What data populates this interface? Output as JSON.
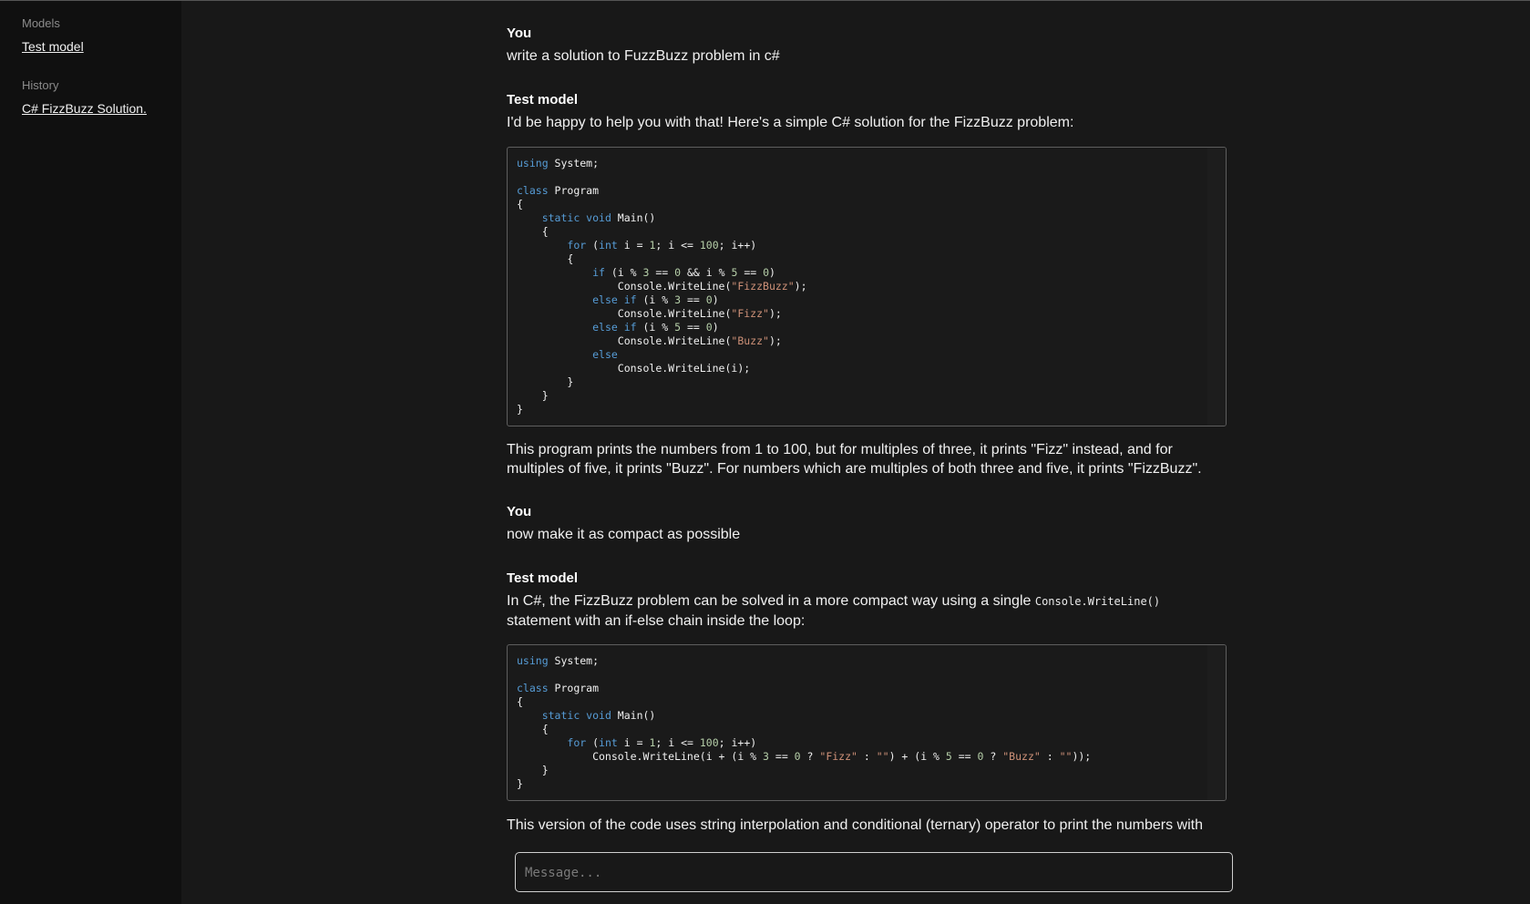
{
  "sidebar": {
    "models_heading": "Models",
    "model_link": "Test model",
    "history_heading": "History",
    "history_link": "C# FizzBuzz Solution."
  },
  "conversation": [
    {
      "author": "You",
      "text": "write a solution to FuzzBuzz problem in c#"
    },
    {
      "author": "Test model",
      "intro": "I'd be happy to help you with that! Here's a simple C# solution for the FizzBuzz problem:",
      "outro": "This program prints the numbers from 1 to 100, but for multiples of three, it prints \"Fizz\" instead, and for multiples of five, it prints \"Buzz\". For numbers which are multiples of both three and five, it prints \"FizzBuzz\"."
    },
    {
      "author": "You",
      "text": "now make it as compact as possible"
    },
    {
      "author": "Test model",
      "intro_before_code": "In C#, the FizzBuzz problem can be solved in a more compact way using a single ",
      "intro_code": "Console.WriteLine()",
      "intro_after_code": "statement with an if-else chain inside the loop:",
      "outro": "This version of the code uses string interpolation and conditional (ternary) operator to print the numbers with their corresponding Fizz or Buzz values."
    }
  ],
  "code": {
    "using": "using",
    "system": " System;",
    "class": "class",
    "program": " Program",
    "static_void": "static void",
    "main": " Main()",
    "for": "for",
    "int": "int",
    "if": "if",
    "else_if": "else if",
    "else": "else",
    "fizzbuzz": "\"FizzBuzz\"",
    "fizz": "\"Fizz\"",
    "buzz": "\"Buzz\"",
    "empty": "\"\"",
    "n0": "0",
    "n1": "1",
    "n3": "3",
    "n5": "5",
    "n100": "100"
  },
  "input": {
    "placeholder": "Message..."
  }
}
